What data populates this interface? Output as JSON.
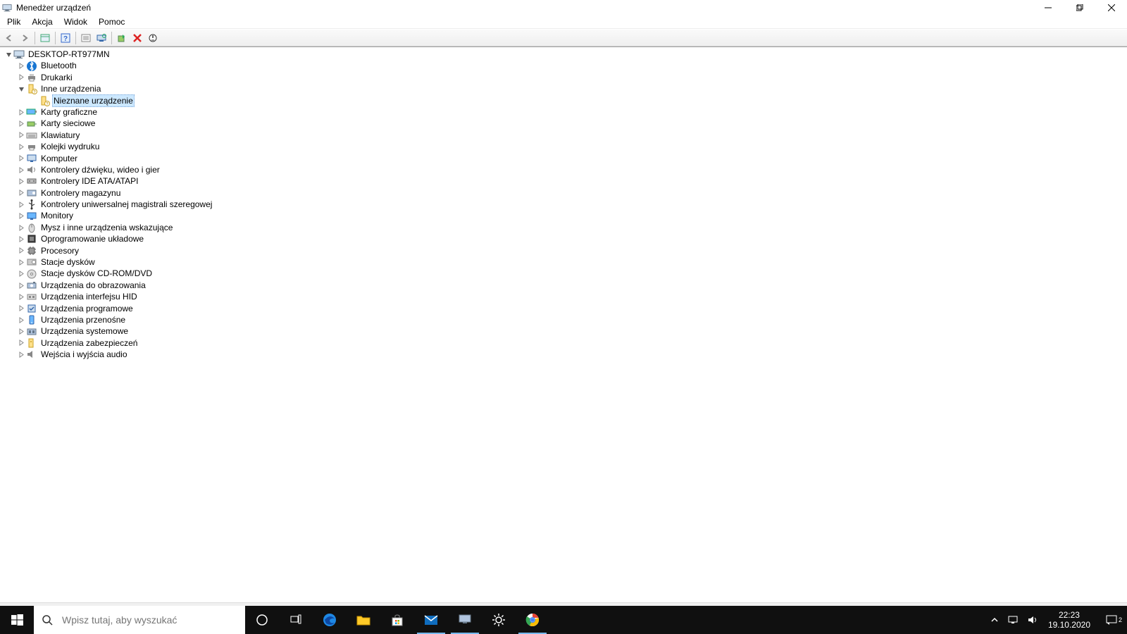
{
  "title": "Menedżer urządzeń",
  "menu": {
    "file": "Plik",
    "action": "Akcja",
    "view": "Widok",
    "help": "Pomoc"
  },
  "root": {
    "label": "DESKTOP-RT977MN"
  },
  "categories": [
    {
      "label": "Bluetooth",
      "icon": "bluetooth",
      "expanded": false,
      "children": []
    },
    {
      "label": "Drukarki",
      "icon": "printer",
      "expanded": false,
      "children": []
    },
    {
      "label": "Inne urządzenia",
      "icon": "other",
      "expanded": true,
      "children": [
        {
          "label": "Nieznane urządzenie",
          "icon": "unknown",
          "selected": true
        }
      ]
    },
    {
      "label": "Karty graficzne",
      "icon": "display-adapter",
      "expanded": false,
      "children": []
    },
    {
      "label": "Karty sieciowe",
      "icon": "network",
      "expanded": false,
      "children": []
    },
    {
      "label": "Klawiatury",
      "icon": "keyboard",
      "expanded": false,
      "children": []
    },
    {
      "label": "Kolejki wydruku",
      "icon": "print-queue",
      "expanded": false,
      "children": []
    },
    {
      "label": "Komputer",
      "icon": "computer",
      "expanded": false,
      "children": []
    },
    {
      "label": "Kontrolery dźwięku, wideo i gier",
      "icon": "sound",
      "expanded": false,
      "children": []
    },
    {
      "label": "Kontrolery IDE ATA/ATAPI",
      "icon": "ide",
      "expanded": false,
      "children": []
    },
    {
      "label": "Kontrolery magazynu",
      "icon": "storage",
      "expanded": false,
      "children": []
    },
    {
      "label": "Kontrolery uniwersalnej magistrali szeregowej",
      "icon": "usb",
      "expanded": false,
      "children": []
    },
    {
      "label": "Monitory",
      "icon": "monitor",
      "expanded": false,
      "children": []
    },
    {
      "label": "Mysz i inne urządzenia wskazujące",
      "icon": "mouse",
      "expanded": false,
      "children": []
    },
    {
      "label": "Oprogramowanie układowe",
      "icon": "firmware",
      "expanded": false,
      "children": []
    },
    {
      "label": "Procesory",
      "icon": "processor",
      "expanded": false,
      "children": []
    },
    {
      "label": "Stacje dysków",
      "icon": "disk",
      "expanded": false,
      "children": []
    },
    {
      "label": "Stacje dysków CD-ROM/DVD",
      "icon": "optical",
      "expanded": false,
      "children": []
    },
    {
      "label": "Urządzenia do obrazowania",
      "icon": "imaging",
      "expanded": false,
      "children": []
    },
    {
      "label": "Urządzenia interfejsu HID",
      "icon": "hid",
      "expanded": false,
      "children": []
    },
    {
      "label": "Urządzenia programowe",
      "icon": "software",
      "expanded": false,
      "children": []
    },
    {
      "label": "Urządzenia przenośne",
      "icon": "portable",
      "expanded": false,
      "children": []
    },
    {
      "label": "Urządzenia systemowe",
      "icon": "system",
      "expanded": false,
      "children": []
    },
    {
      "label": "Urządzenia zabezpieczeń",
      "icon": "security",
      "expanded": false,
      "children": []
    },
    {
      "label": "Wejścia i wyjścia audio",
      "icon": "audio-io",
      "expanded": false,
      "children": []
    }
  ],
  "taskbar": {
    "search_placeholder": "Wpisz tutaj, aby wyszukać",
    "clock_time": "22:23",
    "clock_date": "19.10.2020",
    "notif_count": "2"
  }
}
